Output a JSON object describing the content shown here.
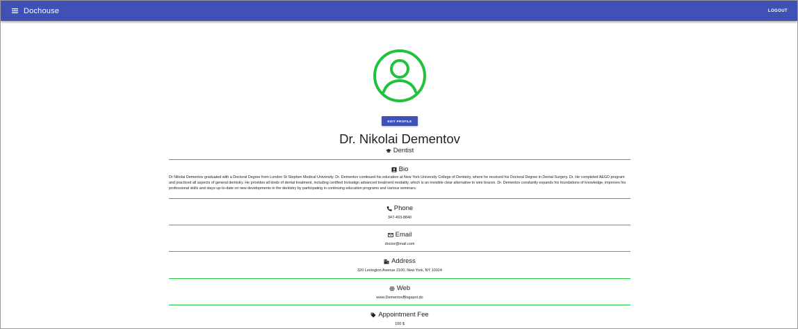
{
  "appbar": {
    "brand": "Dochouse",
    "logout_label": "LOGOUT"
  },
  "profile": {
    "edit_label": "EDIT PROFILE",
    "name": "Dr. Nikolai Dementov",
    "specialty": "Dentist",
    "avatar_color": "#1fc23a"
  },
  "sections": {
    "bio": {
      "title": "Bio",
      "text": "Dr Nikolai Dementov graduated with a Doctoral Degree from London St Stephen Medical University. Dr. Dementov continued his education at New York University College of Dentistry, where he received his Doctoral Degree in Dental Surgery. Dr. He completed AEGD program and practiced all aspects of general dentistry. He provides all kinds of dental treatment, including certified Invisalign advanced treatment modality, which is an invisible clear alternative to wire braces. Dr. Dementov constantly expands his foundations of knowledge, improves his professional skills and stays up-to-date on new developments in the dentistry by participating in continuing education programs and various seminars."
    },
    "phone": {
      "title": "Phone",
      "value": "347-493-8840"
    },
    "email": {
      "title": "Email",
      "value": "doctor@mail.com"
    },
    "address": {
      "title": "Address",
      "value": "320 Lexington Avenue 2100, New York, NY 10024"
    },
    "web": {
      "title": "Web",
      "value": "www.DementovBlogspot.do"
    },
    "fee": {
      "title": "Appointment Fee",
      "value": "100 $"
    }
  },
  "colors": {
    "primary": "#3f51b5",
    "divider": "#1fc23a"
  }
}
